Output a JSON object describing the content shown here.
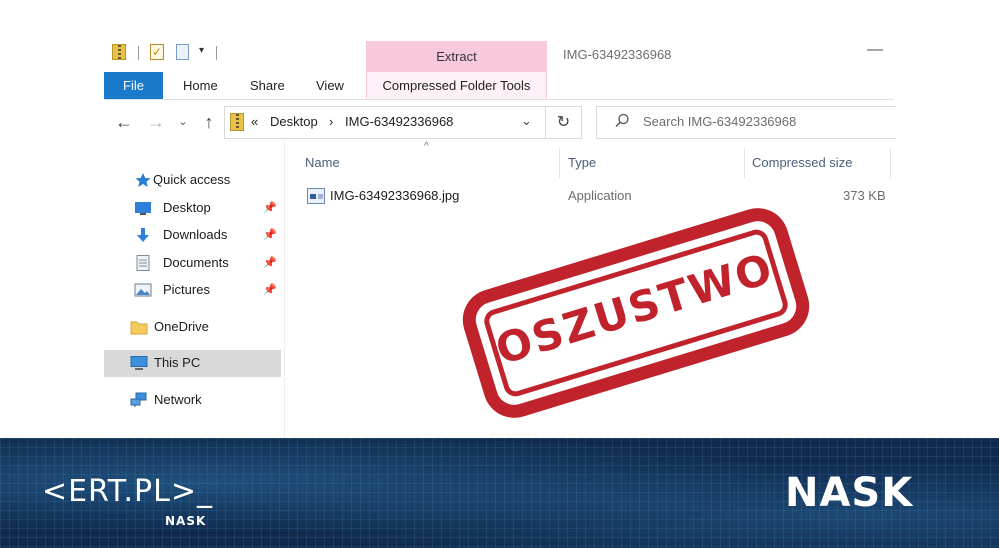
{
  "window": {
    "title": "IMG-63492336968",
    "minimize_glyph": "—",
    "context_tab": "Extract"
  },
  "qat": {
    "dropdown_glyph": "▾"
  },
  "ribbon": {
    "tabs": [
      {
        "label": "File",
        "active": true
      },
      {
        "label": "Home"
      },
      {
        "label": "Share"
      },
      {
        "label": "View"
      },
      {
        "label": "Compressed Folder Tools"
      }
    ]
  },
  "address": {
    "back_glyph": "←",
    "forward_glyph": "→",
    "recent_glyph": "⌄",
    "up_glyph": "↑",
    "overflow": "«",
    "crumbs": [
      "Desktop",
      "IMG-63492336968"
    ],
    "separator": "›",
    "dropdown_glyph": "⌄",
    "refresh_glyph": "↻"
  },
  "search": {
    "placeholder": "Search IMG-63492336968"
  },
  "sidebar": {
    "pin_glyph": "📌",
    "items": [
      {
        "label": "Quick access",
        "icon": "star-icon"
      },
      {
        "label": "Desktop",
        "icon": "desktop-icon",
        "pinned": true
      },
      {
        "label": "Downloads",
        "icon": "download-icon",
        "pinned": true
      },
      {
        "label": "Documents",
        "icon": "documents-icon",
        "pinned": true
      },
      {
        "label": "Pictures",
        "icon": "pictures-icon",
        "pinned": true
      },
      {
        "label": "OneDrive",
        "icon": "folder-icon"
      },
      {
        "label": "This PC",
        "icon": "pc-icon",
        "selected": true
      },
      {
        "label": "Network",
        "icon": "network-icon"
      }
    ]
  },
  "file_list": {
    "sort_glyph": "^",
    "columns": [
      "Name",
      "Type",
      "Compressed size"
    ],
    "rows": [
      {
        "name": "IMG-63492336968.jpg",
        "type": "Application",
        "size": "373 KB"
      }
    ]
  },
  "stamp": {
    "text": "OSZUSTWO",
    "color": "#c0232c"
  },
  "footer": {
    "logo_left": "<ERT.PL>_",
    "logo_left_sub": "NASK",
    "logo_right": "NASK",
    "background": "#102a4d"
  }
}
